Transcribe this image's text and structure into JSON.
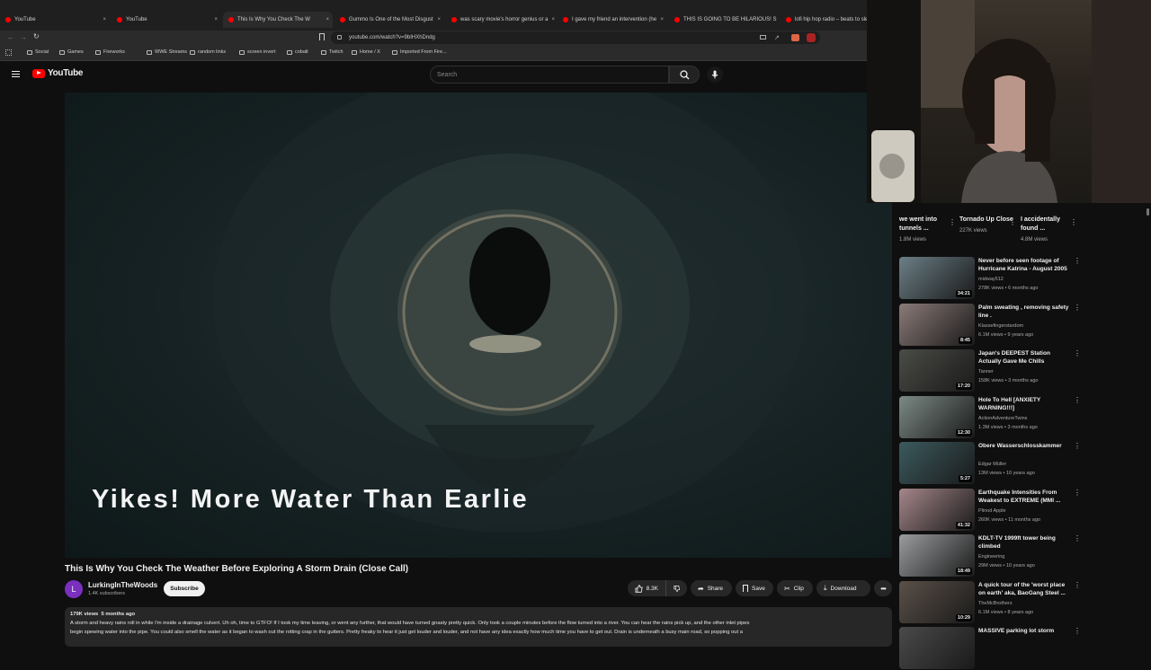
{
  "browser": {
    "tabs": [
      {
        "label": "YouTube"
      },
      {
        "label": "YouTube"
      },
      {
        "label": "This Is Why You Check The W"
      },
      {
        "label": "Gummo Is One of the Most Disgust"
      },
      {
        "label": "was scary movie's horror genius or a"
      },
      {
        "label": "I gave my friend an intervention (he"
      },
      {
        "label": "THIS IS GOING TO BE HILARIOUS! S"
      },
      {
        "label": "lofi hip hop radio – beats to sle"
      }
    ],
    "url": "youtube.com/watch?v=9bIHXhDndg",
    "bookmarks": [
      "Social",
      "Games",
      "Fireworks",
      "WWE Streams",
      "random links",
      "screen invert",
      "cobalt",
      "Twitch",
      "Home / X",
      "Imported From Fire..."
    ]
  },
  "youtube": {
    "logo": "YouTube",
    "search_placeholder": "Search"
  },
  "video": {
    "caption": "Yikes! More Water Than Earlie",
    "title": "This Is Why You Check The Weather Before Exploring A Storm Drain (Close Call)",
    "channel": "LurkingInTheWoods",
    "channel_initial": "L",
    "subscribers": "1.4K subscribers",
    "subscribe_label": "Subscribe",
    "likes": "8.3K",
    "share_label": "Share",
    "save_label": "Save",
    "clip_label": "Clip",
    "download_label": "Download",
    "views": "179K views",
    "age": "5 months ago",
    "description_line1": "A storm and heavy rains roll in while I'm inside a drainage culvert. Uh oh, time to GTFO! If I took my time leaving, or went any further, that would have turned gnasty pretty quick. Only took a couple minutes before the flow turned into a river. You can hear the rains pick up, and the other inlet pipes",
    "description_line2": "begin spewing water into the pipe. You could also smell the water as it began to wash out the rotting crap in the gutters. Pretty freaky to hear it just get louder and louder, and not have any idea exactly how much time you have to get out. Drain is underneath a busy main road, so popping out a"
  },
  "shorts": [
    {
      "title": "we went into tunnels ...",
      "views": "1.8M views"
    },
    {
      "title": "Tornado Up Close",
      "views": "227K views"
    },
    {
      "title": "I accidentally found ...",
      "views": "4.8M views"
    }
  ],
  "recommendations": [
    {
      "title": "Never before seen footage of Hurricane Katrina - August 2005",
      "channel": "midway512",
      "meta": "278K views • 6 months ago",
      "duration": "34:21",
      "color": "#6b7f86"
    },
    {
      "title": "Palm sweating , removing safety line .",
      "channel": "Klassefingerstardom",
      "meta": "6.1M views • 9 years ago",
      "duration": "8:45",
      "color": "#8a7a78"
    },
    {
      "title": "Japan's DEEPEST Station Actually Gave Me Chills",
      "channel": "Tanner",
      "meta": "158K views • 3 months ago",
      "duration": "17:20",
      "color": "#4a4c46"
    },
    {
      "title": "Hole To Hell [ANXIETY WARNING!!!]",
      "channel": "ActionAdventureTwins",
      "meta": "1.3M views • 3 months ago",
      "duration": "12:30",
      "color": "#7c8a86"
    },
    {
      "title": "Obere Wasserschlosskammer",
      "channel": "Edgar Müller",
      "meta": "13M views • 10 years ago",
      "duration": "5:27",
      "color": "#3b5a5e"
    },
    {
      "title": "Earthquake Intensities From Weakest to EXTREME (MMI ...",
      "channel": "Plinod Apple",
      "meta": "260K views • 11 months ago",
      "duration": "41:32",
      "color": "#a4868a"
    },
    {
      "title": "KDLT-TV 1999ft tower being climbed",
      "channel": "Engineering",
      "meta": "29M views • 10 years ago",
      "duration": "18:49",
      "color": "#9a9c9e"
    },
    {
      "title": "A quick tour of the 'worst place on earth' aka, BaoGang Steel ...",
      "channel": "TheMcBrothers",
      "meta": "6.1M views • 8 years ago",
      "duration": "10:29",
      "color": "#5a5048"
    },
    {
      "title": "MASSIVE parking lot storm",
      "channel": "",
      "meta": "",
      "duration": "",
      "color": "#4a4a4a"
    }
  ]
}
